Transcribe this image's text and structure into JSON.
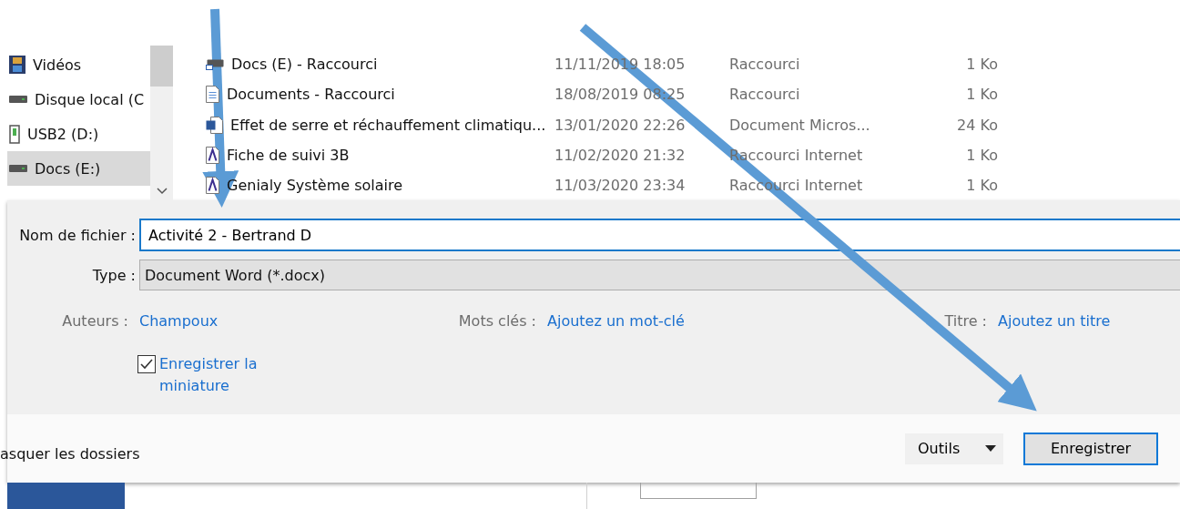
{
  "nav": {
    "items": [
      {
        "label": "Vidéos",
        "selected": false
      },
      {
        "label": "Disque local (C",
        "selected": false
      },
      {
        "label": "USB2 (D:)",
        "selected": false
      },
      {
        "label": "Docs (E:)",
        "selected": true
      }
    ]
  },
  "files": {
    "rows": [
      {
        "name": "Docs (E) - Raccourci",
        "date": "11/11/2019 18:05",
        "type": "Raccourci",
        "size": "1 Ko"
      },
      {
        "name": "Documents - Raccourci",
        "date": "18/08/2019 08:25",
        "type": "Raccourci",
        "size": "1 Ko"
      },
      {
        "name": "Effet de serre et réchauffement climatiqu...",
        "date": "13/01/2020 22:26",
        "type": "Document Micros...",
        "size": "24 Ko"
      },
      {
        "name": "Fiche de suivi 3B",
        "date": "11/02/2020 21:32",
        "type": "Raccourci Internet",
        "size": "1 Ko"
      },
      {
        "name": "Genialy Système solaire",
        "date": "11/03/2020 23:34",
        "type": "Raccourci Internet",
        "size": "1 Ko"
      }
    ]
  },
  "save": {
    "filename_label": "Nom de fichier :",
    "filename": "Activité 2 - Bertrand D",
    "type_label": "Type :",
    "type": "Document Word (*.docx)",
    "meta": [
      {
        "label": "Auteurs :",
        "value": "Champoux"
      },
      {
        "label": "Mots clés :",
        "value": "Ajoutez un mot-clé"
      },
      {
        "label": "Titre :",
        "value": "Ajoutez un titre"
      }
    ],
    "thumbnail": {
      "label": "Enregistrer la miniature",
      "checked": true
    },
    "hide_folders": "asquer les dossiers",
    "tools": "Outils",
    "save_button": "Enregistrer"
  }
}
